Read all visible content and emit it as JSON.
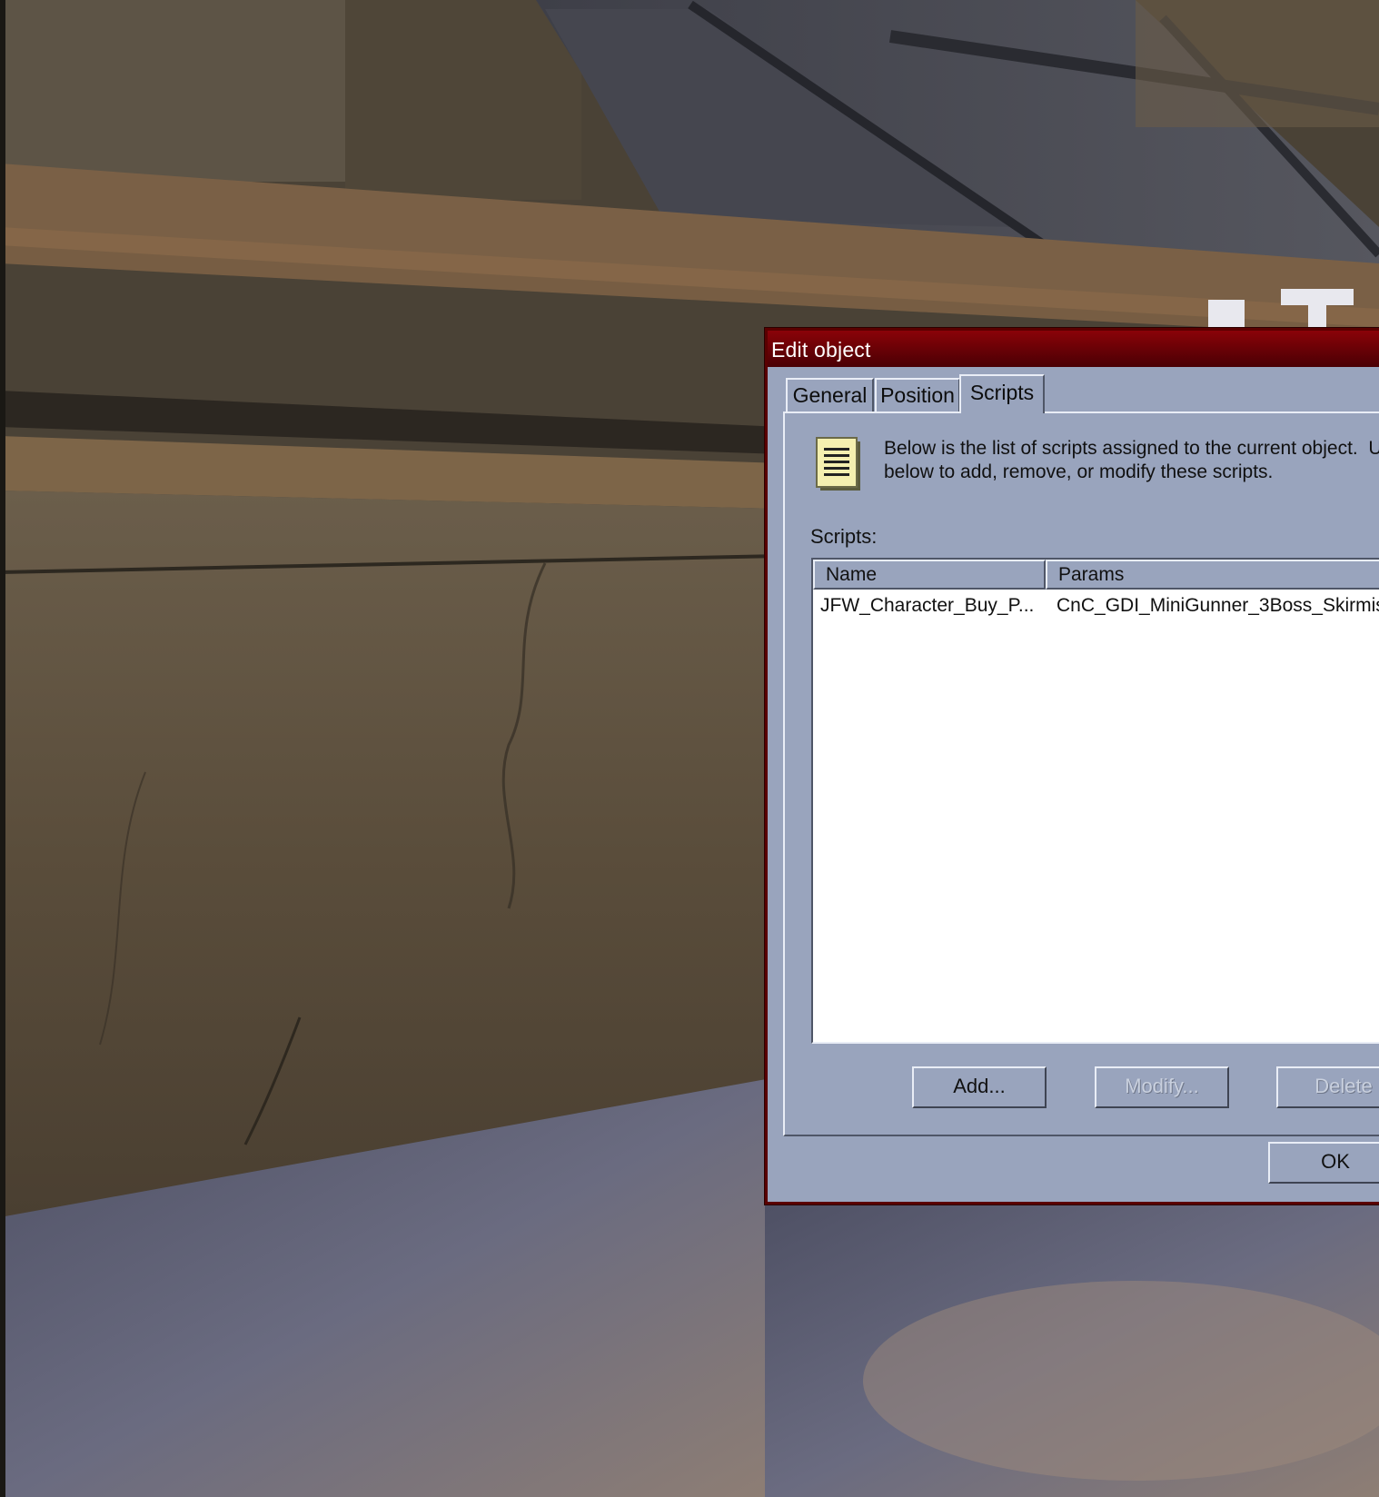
{
  "dialog": {
    "title": "Edit object",
    "tabs": [
      {
        "label": "General"
      },
      {
        "label": "Position"
      },
      {
        "label": "Scripts",
        "active": true
      }
    ],
    "description": "Below is the list of scripts assigned to the current object.  U\nbelow to add, remove, or modify these scripts.",
    "scripts_label": "Scripts:",
    "list": {
      "columns": [
        "Name",
        "Params"
      ],
      "rows": [
        {
          "name": "JFW_Character_Buy_P...",
          "params": "CnC_GDI_MiniGunner_3Boss_Skirmis"
        }
      ]
    },
    "buttons": {
      "add": "Add...",
      "modify": "Modify...",
      "delete": "Delete",
      "ok": "OK"
    }
  },
  "colors": {
    "titlebar": "#7a0006",
    "dialog_face": "#99a4bd",
    "list_background": "#ffffff"
  },
  "icons": {
    "document": "document-lines-icon"
  }
}
